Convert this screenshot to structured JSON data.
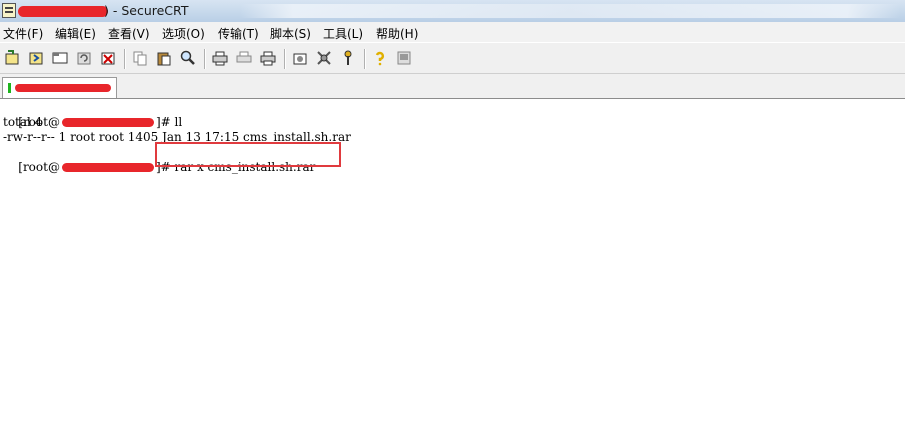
{
  "window": {
    "title_suffix": ") - SecureCRT",
    "redacted_prefix": "redacted-host-name"
  },
  "menu": [
    {
      "label": "文件(F)"
    },
    {
      "label": "编辑(E)"
    },
    {
      "label": "查看(V)"
    },
    {
      "label": "选项(O)"
    },
    {
      "label": "传输(T)"
    },
    {
      "label": "脚本(S)"
    },
    {
      "label": "工具(L)"
    },
    {
      "label": "帮助(H)"
    }
  ],
  "toolbar": {
    "icons": [
      "connect-icon",
      "quick-connect-icon",
      "connect-tab-icon",
      "reconnect-icon",
      "disconnect-icon",
      "copy-icon",
      "paste-icon",
      "find-icon",
      "print-setup-icon",
      "print-screen-icon",
      "print-icon",
      "session-options-icon",
      "global-options-icon",
      "keymap-icon",
      "help-icon",
      "about-icon"
    ]
  },
  "tab": {
    "status": "connected",
    "status_color": "#1eb41e"
  },
  "terminal": {
    "prompt_open": "[root@",
    "line1_suffix": "]# ll",
    "line2": "total 4",
    "line3": "-rw-r--r-- 1 root root 1405 Jan 13 17:15 cms_install.sh.rar",
    "line4_suffix": "]# ",
    "line4_cmd": "rar x cms_install.sh.rar",
    "highlight_color": "#e03a3e",
    "redaction_color": "#e8262b"
  }
}
